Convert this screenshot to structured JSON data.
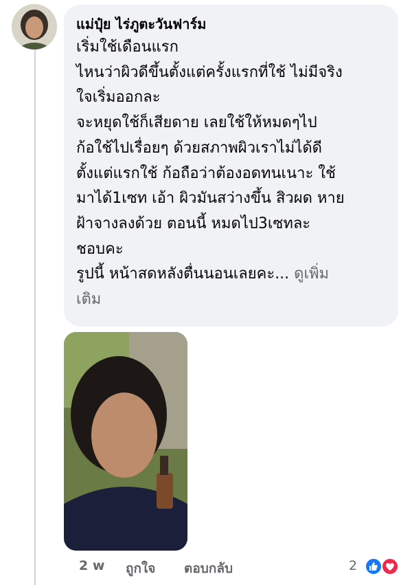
{
  "comment": {
    "author": "แม่ปุ๋ย ไร่ภูตะวันฟาร์ม",
    "lines": [
      "เริ่มใช้เดือนแรก",
      "ไหนว่าผิวดีขึ้นตั้งแต่ครั้งแรกที่ใช้ ไม่มีจริง",
      "ใจเริ่มออกละ",
      "จะหยุดใช้ก็เสียดาย เลยใช้ให้หมดๆไป",
      "ก้อใช้ไปเรื่อยๆ ด้วยสภาพผิวเราไม่ได้ดี",
      "ตั้งแต่แรกใช้ ก้อถือว่าต้องอดทนเนาะ ใช้",
      "มาได้1เซท เอ้า ผิวมันสว่างขึ้น สิวผด หาย",
      "ฝ้าจางลงด้วย ตอนนี้ หมดไป3เซทละ",
      "ชอบคะ",
      "รูปนี้ หน้าสดหลังตื่นนอนเลยคะ..."
    ],
    "see_more": "ดูเพิ่ม",
    "see_more_cont": "เติม"
  },
  "footer": {
    "time": "2 w",
    "like": "ถูกใจ",
    "reply": "ตอบกลับ",
    "reaction_count": "2"
  },
  "reactions": {
    "icons": [
      "like-icon",
      "love-icon"
    ],
    "colors": {
      "like": "#1877f2",
      "love": "#f02849"
    }
  }
}
